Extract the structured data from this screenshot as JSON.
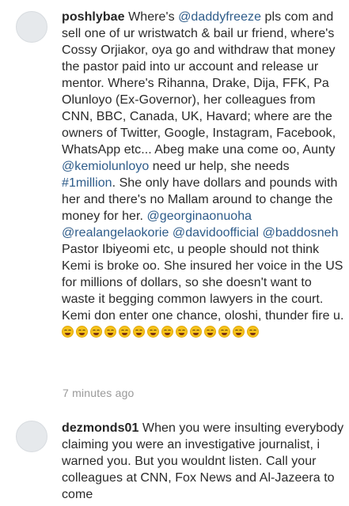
{
  "comments": [
    {
      "username": "poshlybae",
      "segments": [
        {
          "type": "text",
          "text": " Where's "
        },
        {
          "type": "mention",
          "text": "@daddyfreeze"
        },
        {
          "type": "text",
          "text": " pls com and sell one of ur wristwatch & bail ur friend, where's Cossy Orjiakor, oya go and withdraw that money the pastor paid into ur account and release ur mentor. Where's Rihanna, Drake, Dija, FFK, Pa Olunloyo (Ex-Governor), her colleagues from CNN, BBC, Canada, UK, Havard; where are the owners of Twitter, Google, Instagram, Facebook, WhatsApp etc... Abeg make una come oo, Aunty "
        },
        {
          "type": "mention",
          "text": "@kemiolunloyo"
        },
        {
          "type": "text",
          "text": " need ur help, she needs "
        },
        {
          "type": "hashtag",
          "text": "#1million"
        },
        {
          "type": "text",
          "text": ". She only have dollars and pounds with her and there's no Mallam around to change the money for her. "
        },
        {
          "type": "mention",
          "text": "@georginaonuoha"
        },
        {
          "type": "text",
          "text": " "
        },
        {
          "type": "mention",
          "text": "@realangelaokorie"
        },
        {
          "type": "text",
          "text": " "
        },
        {
          "type": "mention",
          "text": "@davidoofficial"
        },
        {
          "type": "text",
          "text": " "
        },
        {
          "type": "mention",
          "text": "@baddosneh"
        },
        {
          "type": "text",
          "text": " Pastor Ibiyeomi etc, u people should not think Kemi is broke oo. She insured her voice in the US for millions of dollars, so she doesn't want to waste it begging common lawyers in the court. Kemi don enter one chance, oloshi, thunder fire u. "
        }
      ],
      "emoji_count": 14,
      "emoji_icon": "face-with-tears-of-joy-icon",
      "timestamp": "7 minutes ago"
    },
    {
      "username": "dezmonds01",
      "segments": [
        {
          "type": "text",
          "text": " When you were insulting everybody claiming you were an investigative journalist, i warned you. But you wouldnt listen. Call your colleagues at CNN, Fox News and Al-Jazeera to come"
        }
      ]
    }
  ],
  "colors": {
    "link": "#2e5c8a",
    "username": "#262626",
    "text": "#2a2a2a",
    "timestamp": "#9a9a9a",
    "avatar_bg": "#e6e9ec"
  }
}
